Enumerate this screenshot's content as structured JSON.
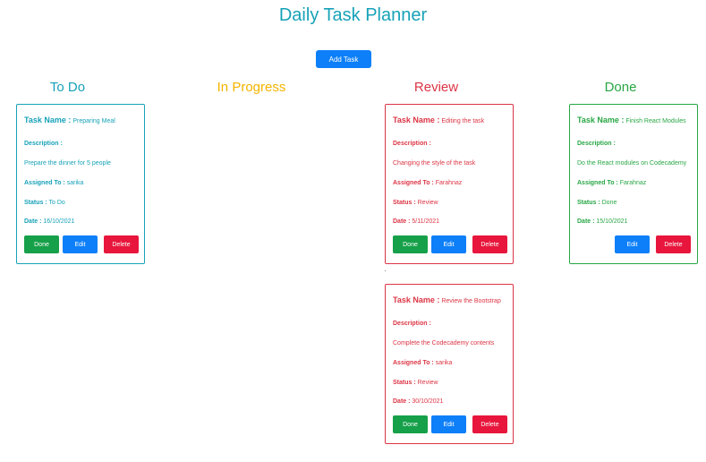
{
  "header": {
    "title": "Daily Task Planner",
    "add_label": "Add Task"
  },
  "columns": {
    "todo": "To Do",
    "progress": "In Progress",
    "review": "Review",
    "done": "Done"
  },
  "labels": {
    "task_name": "Task Name :",
    "description": "Description :",
    "assigned_to": "Assigned To :",
    "status": "Status :",
    "date": "Date :"
  },
  "buttons": {
    "done": "Done",
    "edit": "Edit",
    "delete": "Delete"
  },
  "tasks": {
    "todo_1": {
      "name": "Preparing Meal",
      "description": "Prepare the dinner for 5 people",
      "assigned": "sarika",
      "status": "To Do",
      "date": "16/10/2021"
    },
    "review_1": {
      "name": "Editing the task",
      "description": "Changing the style of the task",
      "assigned": "Farahnaz",
      "status": "Review",
      "date": "5/11/2021"
    },
    "review_2": {
      "name": "Review the Bootstrap",
      "description": "Complete the Codecademy contents",
      "assigned": "sarika",
      "status": "Review",
      "date": "30/10/2021"
    },
    "done_1": {
      "name": "Finish React Modules",
      "description": "Do the React modules on Codecademy",
      "assigned": "Farahnaz",
      "status": "Done",
      "date": "15/10/2021"
    }
  },
  "colors": {
    "todo": "#17a2b8",
    "progress": "#f5b400",
    "review": "#dc3545",
    "done": "#28a745",
    "primary_button": "#0d7ff8",
    "success_button": "#16a049",
    "danger_button": "#e8163c"
  }
}
